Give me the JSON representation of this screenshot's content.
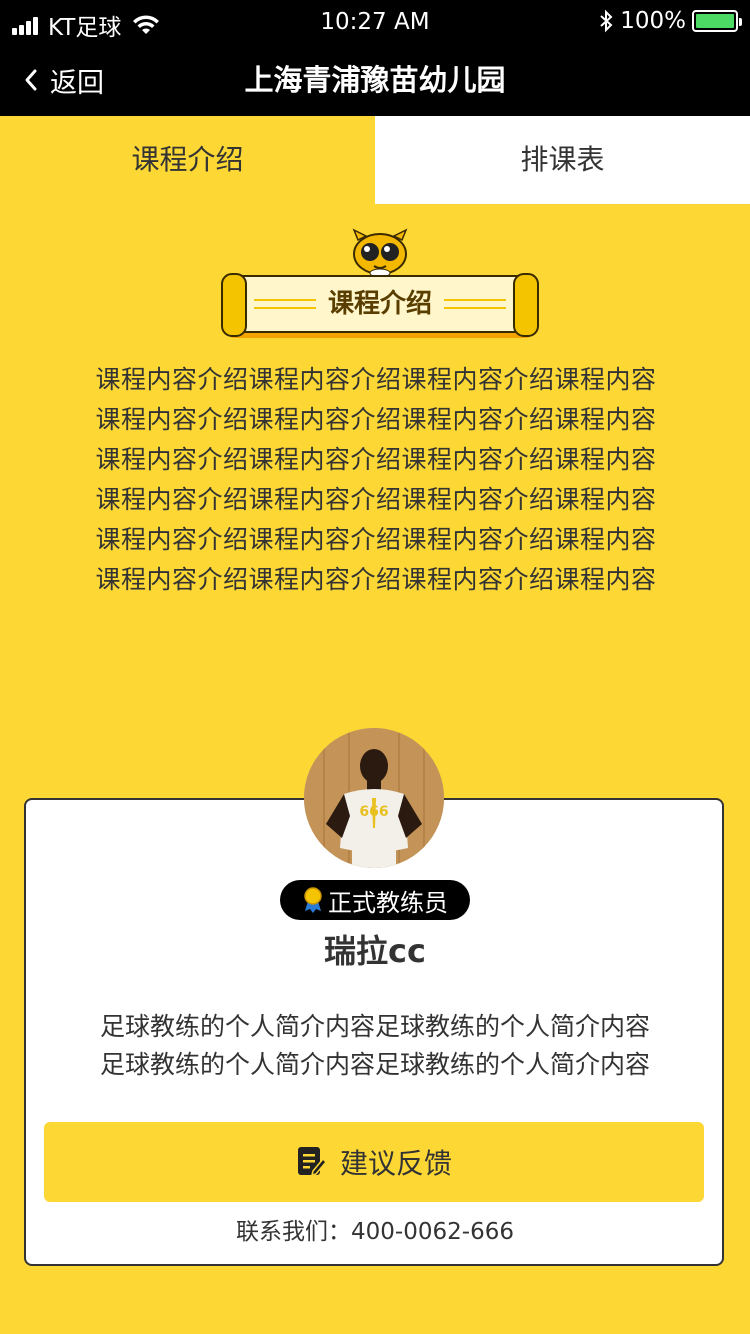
{
  "status_bar": {
    "carrier": "KT足球",
    "time": "10:27 AM",
    "battery_pct": "100%",
    "battery_level": 1.0,
    "battery_color": "#4cd964"
  },
  "nav": {
    "back_label": "返回",
    "title": "上海青浦豫苗幼儿园"
  },
  "tabs": [
    {
      "label": "课程介绍",
      "active": true
    },
    {
      "label": "排课表",
      "active": false
    }
  ],
  "section": {
    "title": "课程介绍"
  },
  "course": {
    "lines": [
      "课程内容介绍课程内容介绍课程内容介绍课程内容",
      "课程内容介绍课程内容介绍课程内容介绍课程内容",
      "课程内容介绍课程内容介绍课程内容介绍课程内容",
      "课程内容介绍课程内容介绍课程内容介绍课程内容",
      "课程内容介绍课程内容介绍课程内容介绍课程内容",
      "课程内容介绍课程内容介绍课程内容介绍课程内容"
    ]
  },
  "coach": {
    "badge": "正式教练员",
    "name": "瑞拉cc",
    "bio_lines": [
      "足球教练的个人简介内容足球教练的个人简介内容",
      "足球教练的个人简介内容足球教练的个人简介内容"
    ],
    "feedback_label": "建议反馈",
    "contact": "联系我们：400-0062-666"
  },
  "colors": {
    "accent": "#fdd835",
    "dark": "#000000",
    "text": "#333333"
  },
  "icons": {
    "back": "chevron-left-icon",
    "wifi": "wifi-icon",
    "bluetooth": "bluetooth-icon",
    "badge": "medal-icon",
    "feedback": "edit-note-icon"
  }
}
